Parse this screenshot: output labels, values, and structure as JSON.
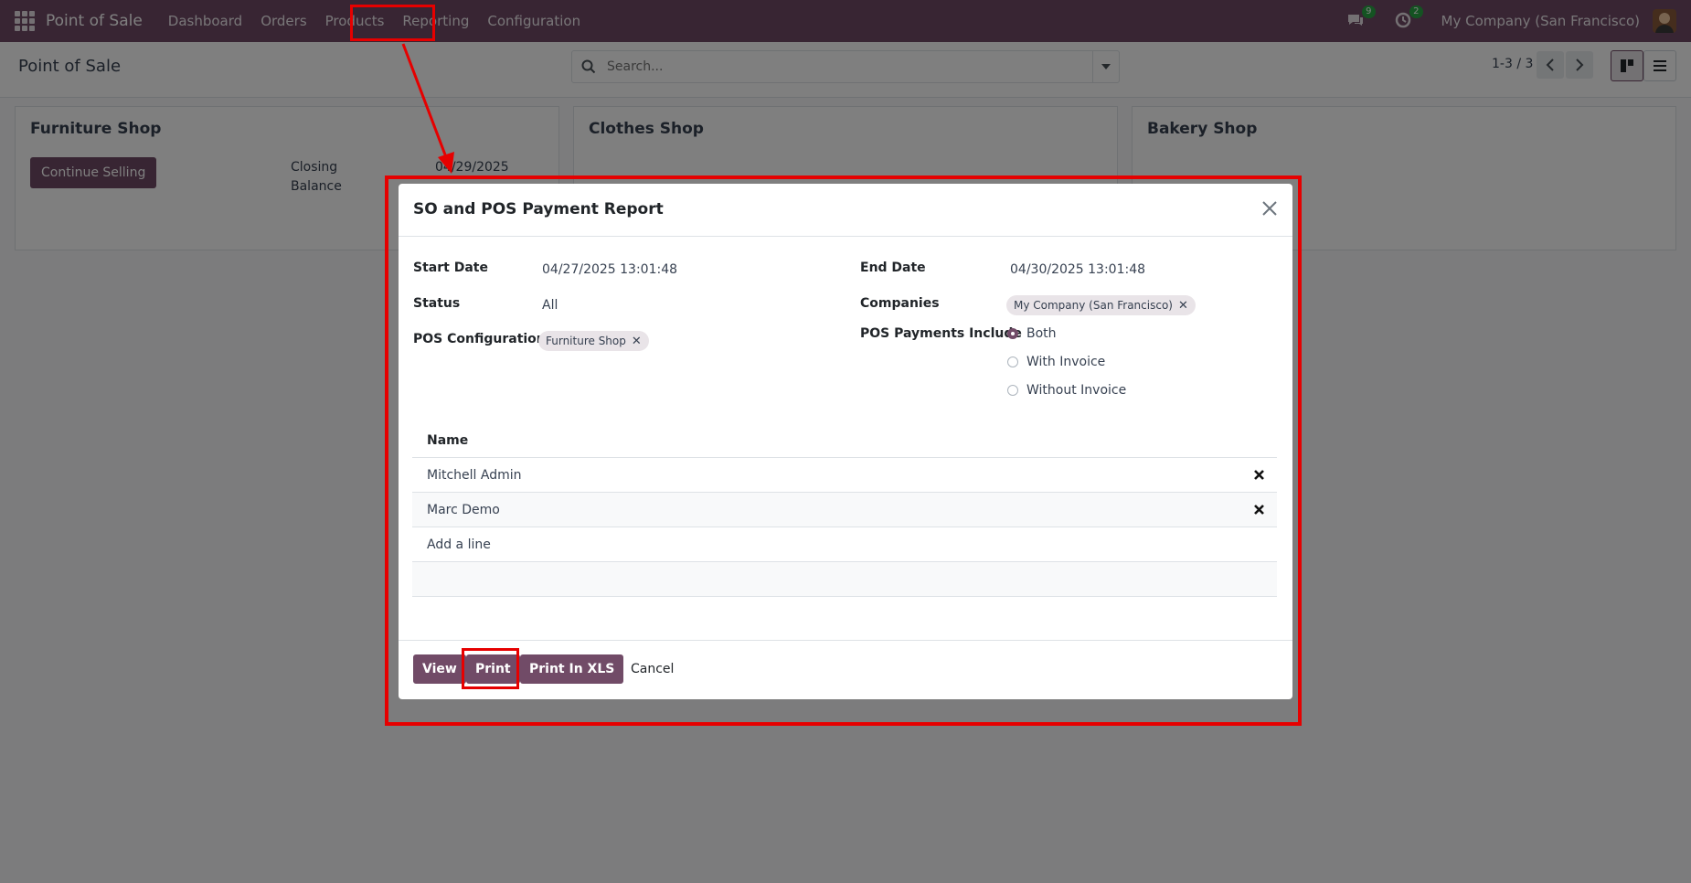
{
  "navbar": {
    "app_name": "Point of Sale",
    "menu": [
      "Dashboard",
      "Orders",
      "Products",
      "Reporting",
      "Configuration"
    ],
    "messages_count": "9",
    "activities_count": "2",
    "company": "My Company (San Francisco)"
  },
  "control": {
    "page_title": "Point of Sale",
    "search_placeholder": "Search...",
    "pager": "1-3 / 3"
  },
  "kanban": {
    "cards": [
      {
        "title": "Furniture Shop",
        "button": "Continue Selling",
        "closing_label": "Closing",
        "balance_label": "Balance",
        "closing_date": "04/29/2025"
      },
      {
        "title": "Clothes Shop"
      },
      {
        "title": "Bakery Shop"
      }
    ]
  },
  "dialog": {
    "title": "SO and POS Payment Report",
    "start_date_label": "Start Date",
    "start_date": "04/27/2025 13:01:48",
    "end_date_label": "End Date",
    "end_date": "04/30/2025 13:01:48",
    "status_label": "Status",
    "status": "All",
    "companies_label": "Companies",
    "company_tag": "My Company (San Francisco)",
    "pos_config_label": "POS Configuration",
    "pos_config_tag": "Furniture Shop",
    "payments_include_label": "POS Payments Include",
    "payment_options": [
      "Both",
      "With Invoice",
      "Without Invoice"
    ],
    "selected_payment_option": "Both",
    "table": {
      "header": "Name",
      "rows": [
        "Mitchell Admin",
        "Marc Demo"
      ],
      "add_line": "Add a line"
    },
    "buttons": {
      "view": "View",
      "print": "Print",
      "print_xls": "Print In XLS",
      "cancel": "Cancel"
    }
  },
  "colors": {
    "brand": "#714B67",
    "highlight": "#e60000"
  }
}
